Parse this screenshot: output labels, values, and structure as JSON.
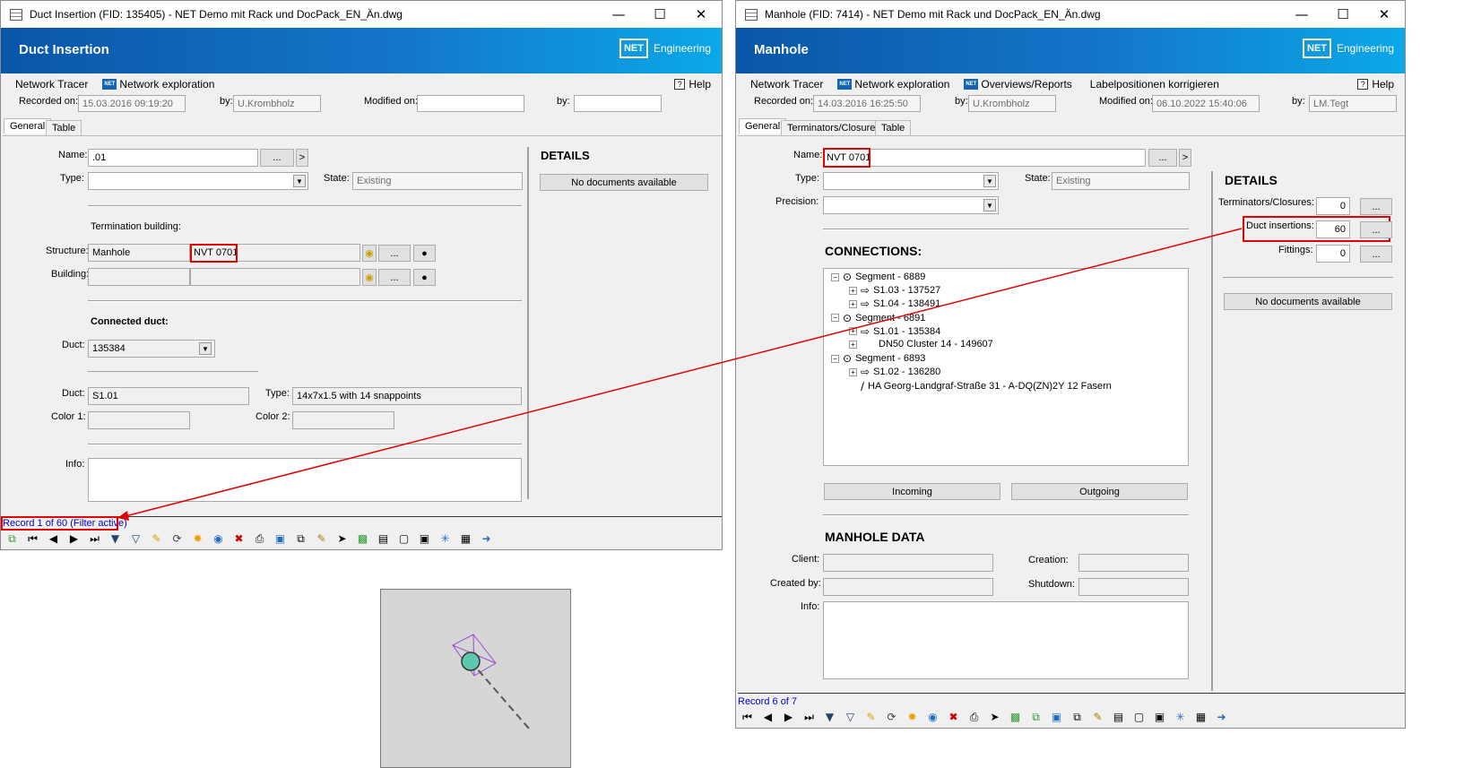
{
  "left": {
    "title": "Duct Insertion (FID: 135405) - NET Demo mit Rack und DocPack_EN_Än.dwg",
    "banner": "Duct Insertion",
    "logo": {
      "box": "NET",
      "text": "Engineering"
    },
    "menu": {
      "network_tracer": "Network Tracer",
      "network_exploration": "Network exploration",
      "help": "Help"
    },
    "recorded_on_label": "Recorded on:",
    "recorded_on": "15.03.2016 09:19:20",
    "by_label": "by:",
    "by": "U.Krombholz",
    "modified_on_label": "Modified on:",
    "modified_on": "",
    "by2": "",
    "tabs": [
      "General",
      "Table"
    ],
    "name_label": "Name:",
    "name": ".01",
    "browse": "...",
    "next": ">",
    "type_label": "Type:",
    "type": "",
    "state_label": "State:",
    "state": "Existing",
    "termination_label": "Termination building:",
    "structure_label": "Structure:",
    "structure_type": "Manhole",
    "structure_name": "NVT 0701",
    "building_label": "Building:",
    "connected_duct_label": "Connected duct:",
    "duct_label": "Duct:",
    "duct": "135384",
    "duct2_label": "Duct:",
    "duct2": "S1.01",
    "type2_label": "Type:",
    "type2": "14x7x1.5 with 14 snappoints",
    "color1_label": "Color 1:",
    "color2_label": "Color 2:",
    "info_label": "Info:",
    "details": "DETAILS",
    "no_docs": "No documents available",
    "record": "Record 1 of 60 (Filter active)"
  },
  "right": {
    "title": "Manhole (FID: 7414) - NET Demo mit Rack und DocPack_EN_Än.dwg",
    "banner": "Manhole",
    "menu": {
      "network_tracer": "Network Tracer",
      "network_exploration": "Network exploration",
      "overviews": "Overviews/Reports",
      "label": "Labelpositionen korrigieren",
      "help": "Help"
    },
    "recorded_on_label": "Recorded on:",
    "recorded_on": "14.03.2016 16:25:50",
    "by_label": "by:",
    "by": "U.Krombholz",
    "modified_on_label": "Modified on:",
    "modified_on": "06.10.2022 15:40:06",
    "by2": "LM.Tegt",
    "tabs": [
      "General",
      "Terminators/Closures",
      "Table"
    ],
    "name_label": "Name:",
    "name": "NVT 0701",
    "type_label": "Type:",
    "state_label": "State:",
    "state": "Existing",
    "precision_label": "Precision:",
    "connections": "CONNECTIONS:",
    "tree": [
      {
        "level": 0,
        "text": "Segment - 6889",
        "icon": "segment-icon"
      },
      {
        "level": 1,
        "text": "S1.03 - 137527",
        "icon": "arrow-icon"
      },
      {
        "level": 1,
        "text": "S1.04 - 138491",
        "icon": "arrow-icon"
      },
      {
        "level": 0,
        "text": "Segment - 6891",
        "icon": "segment-icon"
      },
      {
        "level": 1,
        "text": "S1.01 - 135384",
        "icon": "arrow-icon"
      },
      {
        "level": 1,
        "text": "DN50 Cluster 14 - 149607",
        "icon": "none"
      },
      {
        "level": 0,
        "text": "Segment - 6893",
        "icon": "segment-icon"
      },
      {
        "level": 1,
        "text": "S1.02 - 136280",
        "icon": "arrow-icon"
      },
      {
        "level": 1,
        "text": "HA Georg-Landgraf-Straße 31 - A-DQ(ZN)2Y 12 Fasern",
        "icon": "cable-icon"
      }
    ],
    "incoming": "Incoming",
    "outgoing": "Outgoing",
    "manhole_data": "MANHOLE DATA",
    "client_label": "Client:",
    "creation_label": "Creation:",
    "created_by_label": "Created by:",
    "shutdown_label": "Shutdown:",
    "info_label": "Info:",
    "details": "DETAILS",
    "terminators_label": "Terminators/Closures:",
    "terminators": "0",
    "duct_insertions_label": "Duct insertions:",
    "duct_insertions": "60",
    "fittings_label": "Fittings:",
    "fittings": "0",
    "no_docs": "No documents available",
    "record": "Record 6 of 7"
  },
  "colors": {
    "banner": "#0a56a8",
    "highlight": "#e30000",
    "record_link": "#0000d0"
  }
}
